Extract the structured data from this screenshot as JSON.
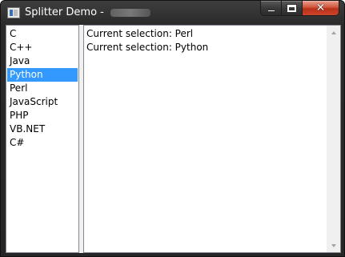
{
  "window": {
    "title": "Splitter Demo - ",
    "icon": "app-window-icon",
    "caption_buttons": {
      "minimize": "minimize-icon",
      "maximize": "maximize-icon",
      "close": "close-icon"
    }
  },
  "list": {
    "items": [
      {
        "label": "C"
      },
      {
        "label": "C++"
      },
      {
        "label": "Java"
      },
      {
        "label": "Python"
      },
      {
        "label": "Perl"
      },
      {
        "label": "JavaScript"
      },
      {
        "label": "PHP"
      },
      {
        "label": "VB.NET"
      },
      {
        "label": "C#"
      }
    ],
    "selected_label": "Python",
    "selection_color": "#3399ff"
  },
  "text_pane": {
    "lines": [
      "Current selection: Perl",
      "Current selection: Python"
    ]
  }
}
